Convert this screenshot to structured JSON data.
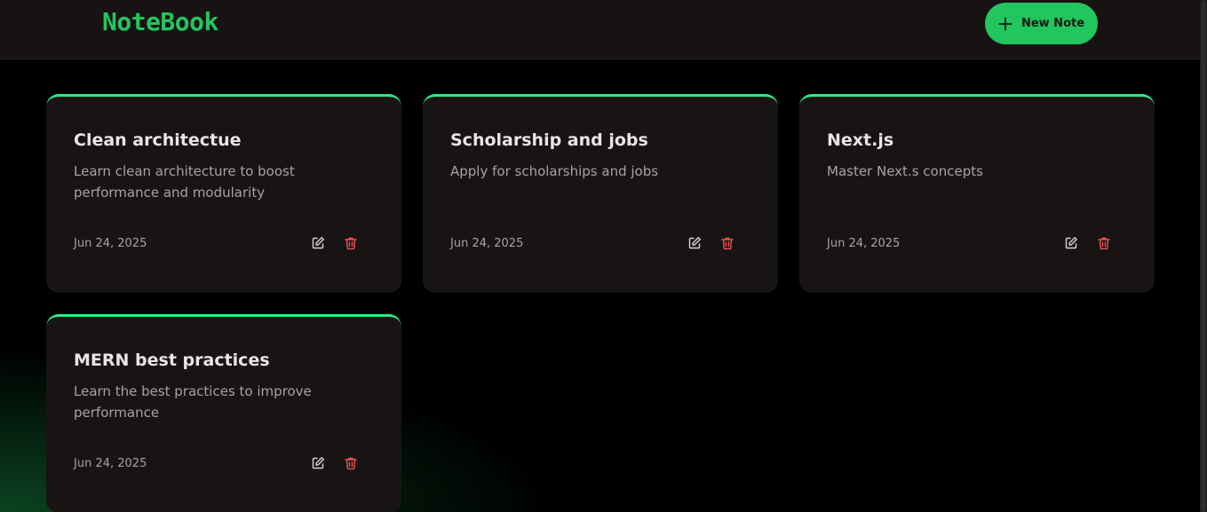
{
  "app": {
    "logo": "NoteBook",
    "new_note_label": "New Note"
  },
  "colors": {
    "accent": "#22c55e",
    "card_top_border": "#2ee88a",
    "delete": "#f05252",
    "card_bg": "#181414"
  },
  "notes": [
    {
      "title": "Clean architectue",
      "description": "Learn clean architecture to boost performance and modularity",
      "date": "Jun 24, 2025"
    },
    {
      "title": "Scholarship and jobs",
      "description": "Apply for scholarships and jobs",
      "date": "Jun 24, 2025"
    },
    {
      "title": "Next.js",
      "description": "Master Next.s concepts",
      "date": "Jun 24, 2025"
    },
    {
      "title": "MERN best practices",
      "description": "Learn the best practices to improve performance",
      "date": "Jun 24, 2025"
    }
  ]
}
